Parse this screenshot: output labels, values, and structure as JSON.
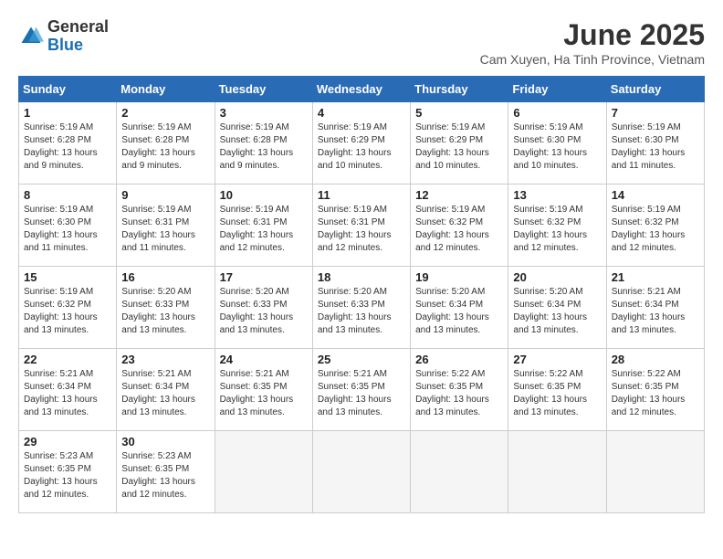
{
  "header": {
    "logo_general": "General",
    "logo_blue": "Blue",
    "title": "June 2025",
    "subtitle": "Cam Xuyen, Ha Tinh Province, Vietnam"
  },
  "calendar": {
    "days_of_week": [
      "Sunday",
      "Monday",
      "Tuesday",
      "Wednesday",
      "Thursday",
      "Friday",
      "Saturday"
    ],
    "weeks": [
      [
        {
          "day": 1,
          "sunrise": "5:19 AM",
          "sunset": "6:28 PM",
          "daylight": "13 hours and 9 minutes."
        },
        {
          "day": 2,
          "sunrise": "5:19 AM",
          "sunset": "6:28 PM",
          "daylight": "13 hours and 9 minutes."
        },
        {
          "day": 3,
          "sunrise": "5:19 AM",
          "sunset": "6:28 PM",
          "daylight": "13 hours and 9 minutes."
        },
        {
          "day": 4,
          "sunrise": "5:19 AM",
          "sunset": "6:29 PM",
          "daylight": "13 hours and 10 minutes."
        },
        {
          "day": 5,
          "sunrise": "5:19 AM",
          "sunset": "6:29 PM",
          "daylight": "13 hours and 10 minutes."
        },
        {
          "day": 6,
          "sunrise": "5:19 AM",
          "sunset": "6:30 PM",
          "daylight": "13 hours and 10 minutes."
        },
        {
          "day": 7,
          "sunrise": "5:19 AM",
          "sunset": "6:30 PM",
          "daylight": "13 hours and 11 minutes."
        }
      ],
      [
        {
          "day": 8,
          "sunrise": "5:19 AM",
          "sunset": "6:30 PM",
          "daylight": "13 hours and 11 minutes."
        },
        {
          "day": 9,
          "sunrise": "5:19 AM",
          "sunset": "6:31 PM",
          "daylight": "13 hours and 11 minutes."
        },
        {
          "day": 10,
          "sunrise": "5:19 AM",
          "sunset": "6:31 PM",
          "daylight": "13 hours and 12 minutes."
        },
        {
          "day": 11,
          "sunrise": "5:19 AM",
          "sunset": "6:31 PM",
          "daylight": "13 hours and 12 minutes."
        },
        {
          "day": 12,
          "sunrise": "5:19 AM",
          "sunset": "6:32 PM",
          "daylight": "13 hours and 12 minutes."
        },
        {
          "day": 13,
          "sunrise": "5:19 AM",
          "sunset": "6:32 PM",
          "daylight": "13 hours and 12 minutes."
        },
        {
          "day": 14,
          "sunrise": "5:19 AM",
          "sunset": "6:32 PM",
          "daylight": "13 hours and 12 minutes."
        }
      ],
      [
        {
          "day": 15,
          "sunrise": "5:19 AM",
          "sunset": "6:32 PM",
          "daylight": "13 hours and 13 minutes."
        },
        {
          "day": 16,
          "sunrise": "5:20 AM",
          "sunset": "6:33 PM",
          "daylight": "13 hours and 13 minutes."
        },
        {
          "day": 17,
          "sunrise": "5:20 AM",
          "sunset": "6:33 PM",
          "daylight": "13 hours and 13 minutes."
        },
        {
          "day": 18,
          "sunrise": "5:20 AM",
          "sunset": "6:33 PM",
          "daylight": "13 hours and 13 minutes."
        },
        {
          "day": 19,
          "sunrise": "5:20 AM",
          "sunset": "6:34 PM",
          "daylight": "13 hours and 13 minutes."
        },
        {
          "day": 20,
          "sunrise": "5:20 AM",
          "sunset": "6:34 PM",
          "daylight": "13 hours and 13 minutes."
        },
        {
          "day": 21,
          "sunrise": "5:21 AM",
          "sunset": "6:34 PM",
          "daylight": "13 hours and 13 minutes."
        }
      ],
      [
        {
          "day": 22,
          "sunrise": "5:21 AM",
          "sunset": "6:34 PM",
          "daylight": "13 hours and 13 minutes."
        },
        {
          "day": 23,
          "sunrise": "5:21 AM",
          "sunset": "6:34 PM",
          "daylight": "13 hours and 13 minutes."
        },
        {
          "day": 24,
          "sunrise": "5:21 AM",
          "sunset": "6:35 PM",
          "daylight": "13 hours and 13 minutes."
        },
        {
          "day": 25,
          "sunrise": "5:21 AM",
          "sunset": "6:35 PM",
          "daylight": "13 hours and 13 minutes."
        },
        {
          "day": 26,
          "sunrise": "5:22 AM",
          "sunset": "6:35 PM",
          "daylight": "13 hours and 13 minutes."
        },
        {
          "day": 27,
          "sunrise": "5:22 AM",
          "sunset": "6:35 PM",
          "daylight": "13 hours and 13 minutes."
        },
        {
          "day": 28,
          "sunrise": "5:22 AM",
          "sunset": "6:35 PM",
          "daylight": "13 hours and 12 minutes."
        }
      ],
      [
        {
          "day": 29,
          "sunrise": "5:23 AM",
          "sunset": "6:35 PM",
          "daylight": "13 hours and 12 minutes."
        },
        {
          "day": 30,
          "sunrise": "5:23 AM",
          "sunset": "6:35 PM",
          "daylight": "13 hours and 12 minutes."
        },
        null,
        null,
        null,
        null,
        null
      ]
    ]
  }
}
